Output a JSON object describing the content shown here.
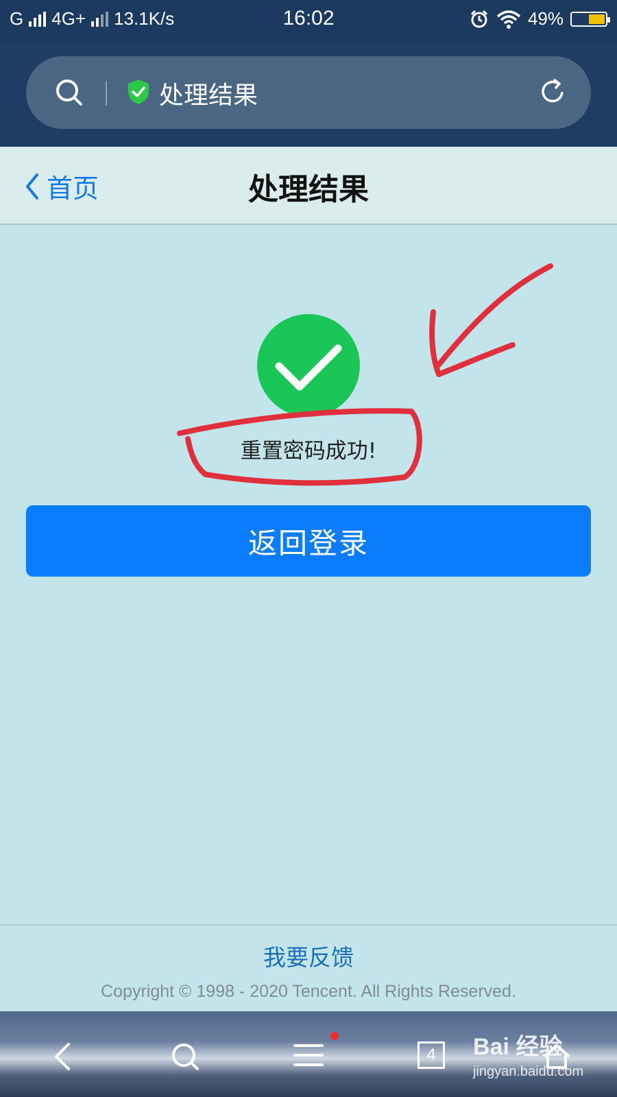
{
  "status_bar": {
    "carrier1": "G",
    "carrier2": "4G+",
    "speed": "13.1K/s",
    "time": "16:02",
    "battery_percent": "49%",
    "battery_level": 0.49,
    "icons": [
      "signal-icon",
      "alarm-icon",
      "wifi-icon",
      "battery-icon"
    ]
  },
  "browser": {
    "address_title": "处理结果",
    "icons": [
      "search-icon",
      "shield-check-icon",
      "refresh-icon"
    ]
  },
  "nav": {
    "back_label": "首页",
    "title": "处理结果"
  },
  "result": {
    "message": "重置密码成功!",
    "button_label": "返回登录",
    "success_color": "#19c656",
    "button_color": "#0b7cfb"
  },
  "footer": {
    "feedback_link": "我要反馈",
    "copyright": "Copyright © 1998 - 2020 Tencent. All Rights Reserved."
  },
  "bottom_bar": {
    "tab_count": "4",
    "watermark_brand": "Bai 经验",
    "watermark_site": "jingyan.baidu.com",
    "icons": [
      "back-icon",
      "search-icon",
      "menu-icon",
      "tabs-icon",
      "home-icon"
    ]
  },
  "annotation_color": "#e0303e"
}
